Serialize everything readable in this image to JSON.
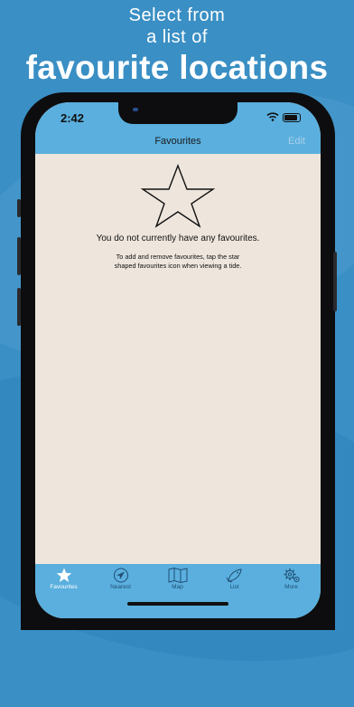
{
  "promo": {
    "line1": "Select from",
    "line2": "a list of",
    "line3": "favourite locations"
  },
  "status": {
    "time": "2:42"
  },
  "nav": {
    "title": "Favourites",
    "edit_label": "Edit"
  },
  "empty_state": {
    "icon": "star-outline-icon",
    "message": "You do not currently have any favourites.",
    "help_line1": "To add and remove favourites, tap the star",
    "help_line2": "shaped favourites icon when viewing a tide."
  },
  "tabs": [
    {
      "label": "Favourites",
      "icon": "star-icon",
      "active": true
    },
    {
      "label": "Nearest",
      "icon": "location-arrow-icon",
      "active": false
    },
    {
      "label": "Map",
      "icon": "map-icon",
      "active": false
    },
    {
      "label": "List",
      "icon": "fish-icon",
      "active": false
    },
    {
      "label": "More",
      "icon": "gear-icon",
      "active": false
    }
  ],
  "colors": {
    "background": "#3a8fc4",
    "bar": "#5aafde",
    "content": "#eee6dd",
    "edit_disabled": "#a9d0ea"
  }
}
